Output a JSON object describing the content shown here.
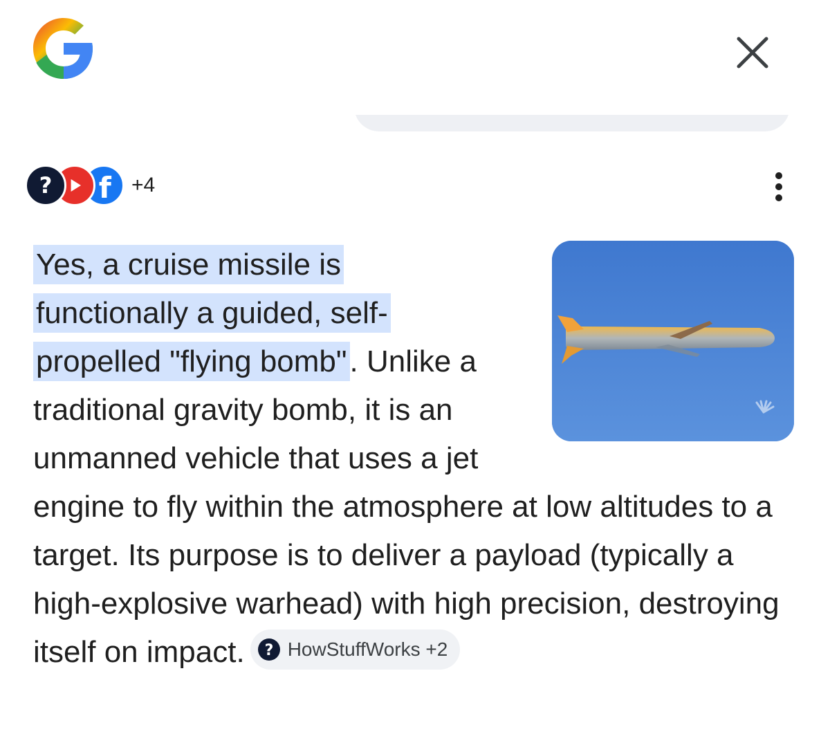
{
  "header": {
    "logo_icon": "google-g-logo",
    "close_icon": "close-icon"
  },
  "sources": {
    "icons": [
      "howstuffworks-icon",
      "youtube-icon",
      "facebook-icon"
    ],
    "more_count": "+4",
    "menu_icon": "more-vert-icon"
  },
  "answer": {
    "highlight_line_1": "Yes, a cruise missile is",
    "highlight_line_2": "functionally a guided, self-",
    "highlight_line_3": "propelled \"flying bomb\"",
    "body": ". Unlike a traditional gravity bomb, it is an unmanned vehicle that uses a jet engine to fly within the atmosphere at low altitudes to a target. Its purpose is to deliver a payload (typically a high-explosive warhead) with high precision, destroying itself on impact.",
    "image_subject": "cruise missile in flight against blue sky",
    "citation": {
      "icon": "howstuffworks-icon",
      "label": "HowStuffWorks +2"
    }
  },
  "colors": {
    "highlight": "#d3e3fd",
    "chip_bg": "#f0f2f5",
    "sky": "#4f86d6"
  }
}
